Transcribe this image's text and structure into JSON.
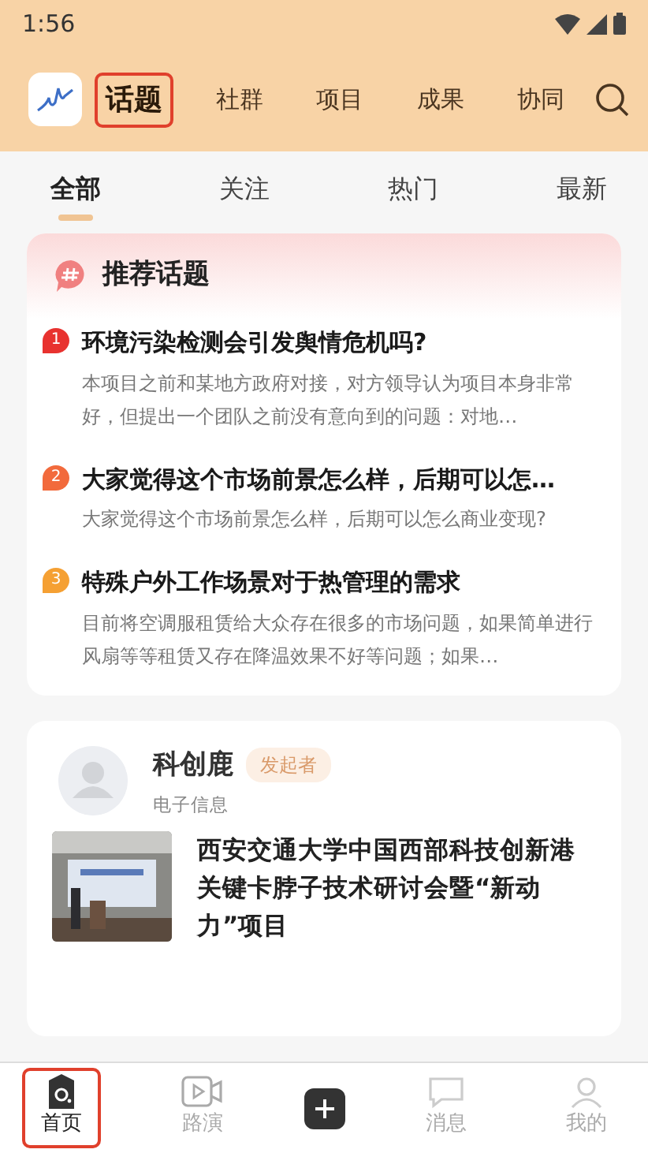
{
  "status_bar": {
    "time": "1:56"
  },
  "top_nav": {
    "tabs": [
      {
        "label": "话题",
        "selected": true,
        "highlighted": true
      },
      {
        "label": "社群",
        "selected": false,
        "highlighted": false
      },
      {
        "label": "项目",
        "selected": false,
        "highlighted": false
      },
      {
        "label": "成果",
        "selected": false,
        "highlighted": false
      },
      {
        "label": "协同",
        "selected": false,
        "highlighted": false
      }
    ]
  },
  "sub_tabs": [
    {
      "label": "全部",
      "selected": true
    },
    {
      "label": "关注",
      "selected": false
    },
    {
      "label": "热门",
      "selected": false
    },
    {
      "label": "最新",
      "selected": false
    }
  ],
  "recommended": {
    "title": "推荐话题",
    "items": [
      {
        "rank": "1",
        "color": "#e8322f",
        "title": "环境污染检测会引发舆情危机吗?",
        "summary": "本项目之前和某地方政府对接，对方领导认为项目本身非常好，但提出一个团队之前没有意向到的问题：对地…"
      },
      {
        "rank": "2",
        "color": "#f26a3c",
        "title": "大家觉得这个市场前景怎么样，后期可以怎…",
        "summary": "大家觉得这个市场前景怎么样，后期可以怎么商业变现?"
      },
      {
        "rank": "3",
        "color": "#f5a033",
        "title": "特殊户外工作场景对于热管理的需求",
        "summary": "目前将空调服租赁给大众存在很多的市场问题，如果简单进行风扇等等租赁又存在降温效果不好等问题；如果…"
      }
    ]
  },
  "post": {
    "author": "科创鹿",
    "badge": "发起者",
    "field": "电子信息",
    "title": "西安交通大学中国西部科技创新港关键卡脖子技术研讨会暨“新动力”项目"
  },
  "bottom_nav": [
    {
      "kind": "home",
      "label": "首页",
      "selected": true,
      "highlighted": true
    },
    {
      "kind": "video",
      "label": "路演",
      "selected": false,
      "highlighted": false
    },
    {
      "kind": "add",
      "selected": false,
      "highlighted": false
    },
    {
      "kind": "message",
      "label": "消息",
      "selected": false,
      "highlighted": false
    },
    {
      "kind": "me",
      "label": "我的",
      "selected": false,
      "highlighted": false
    }
  ]
}
